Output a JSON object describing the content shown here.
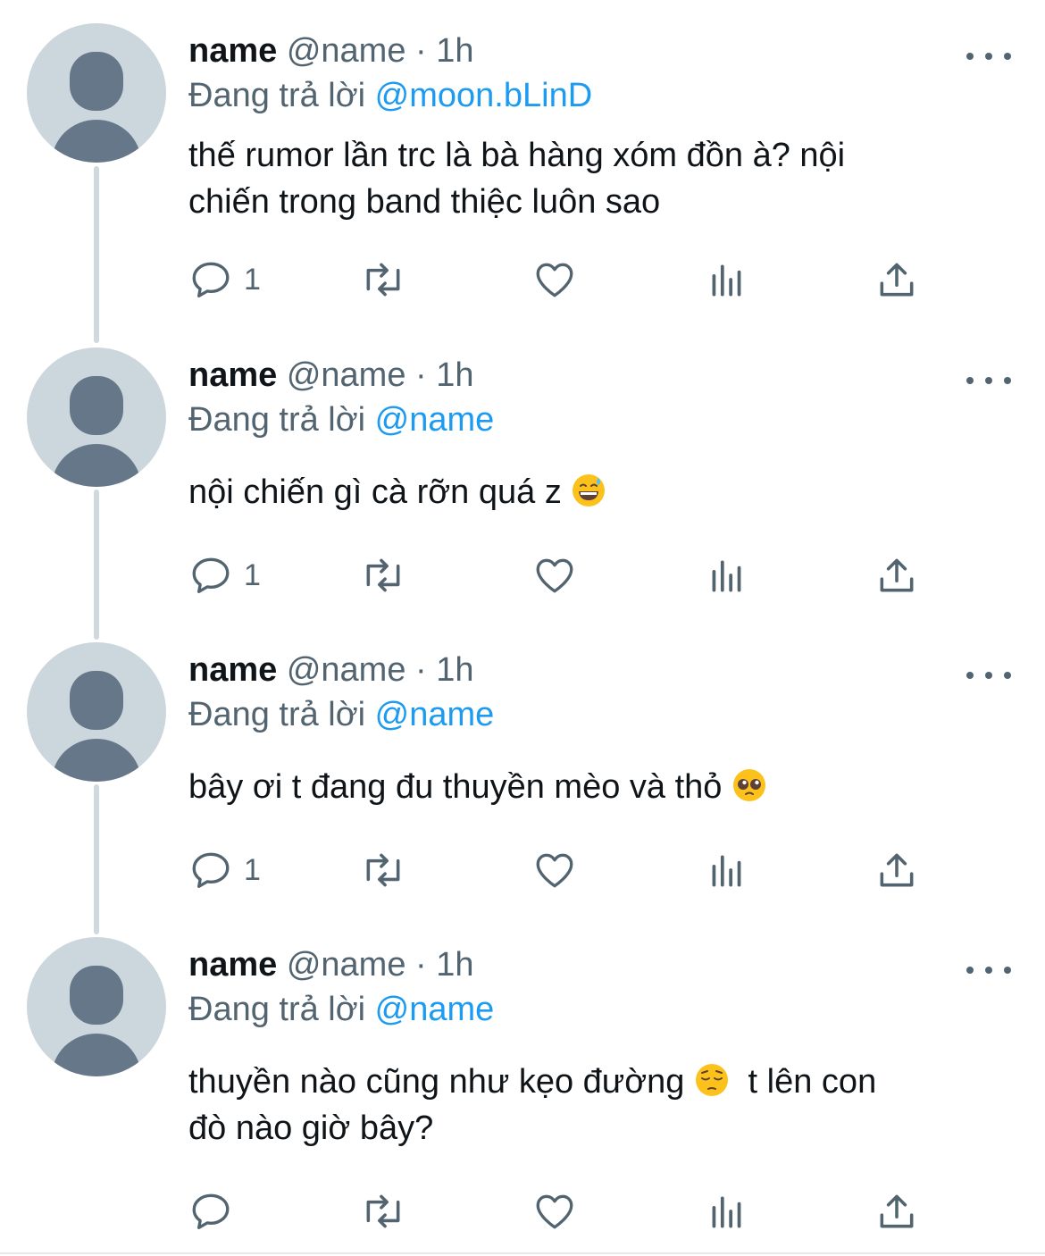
{
  "tweets": [
    {
      "name": "name",
      "handle": "@name",
      "dot": "·",
      "time": "1h",
      "replying_prefix": "Đang trả lời",
      "replying_to": "@moon.bLinD",
      "text_line1": "thế rumor lần trc là bà hàng xóm đồn à? nội",
      "text_line2": "chiến trong band thiệc luôn sao",
      "reply_count": "1",
      "retweet_count": "",
      "like_count": ""
    },
    {
      "name": "name",
      "handle": "@name",
      "dot": "·",
      "time": "1h",
      "replying_prefix": "Đang trả lời",
      "replying_to": "@name",
      "text_line1": "nội chiến gì cà rỡn quá z",
      "text_emoji": "grinning-face-with-sweat-emoji",
      "reply_count": "1",
      "retweet_count": "",
      "like_count": ""
    },
    {
      "name": "name",
      "handle": "@name",
      "dot": "·",
      "time": "1h",
      "replying_prefix": "Đang trả lời",
      "replying_to": "@name",
      "text_line1": "bây ơi t đang đu thuyền mèo và thỏ",
      "text_emoji": "pleading-face-emoji",
      "reply_count": "1",
      "retweet_count": "",
      "like_count": ""
    },
    {
      "name": "name",
      "handle": "@name",
      "dot": "·",
      "time": "1h",
      "replying_prefix": "Đang trả lời",
      "replying_to": "@name",
      "text_line1_a": "thuyền nào cũng như kẹo đường",
      "text_emoji": "pensive-face-emoji",
      "text_line1_b": "t lên con",
      "text_line2": "đò nào giờ bây?",
      "reply_count": "",
      "retweet_count": "",
      "like_count": ""
    }
  ],
  "icons": {
    "reply": "reply-icon",
    "retweet": "retweet-icon",
    "like": "heart-icon",
    "views": "views-icon",
    "share": "share-icon",
    "more": "more-icon"
  },
  "colors": {
    "accent": "#1d9bf0",
    "secondary_text": "#536471",
    "avatar_bg": "#ccd6dd",
    "avatar_fg": "#66778a",
    "thread_line": "#cfd9de"
  }
}
